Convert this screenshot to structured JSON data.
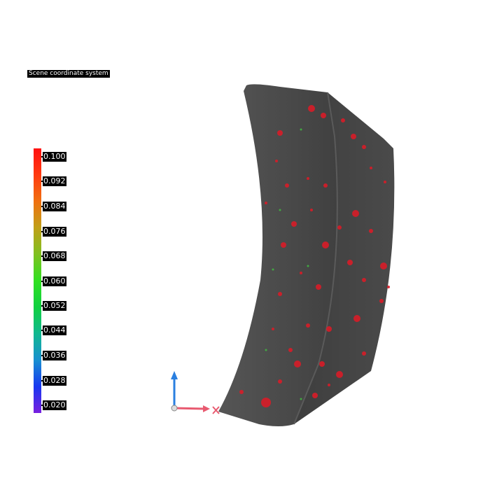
{
  "scene": {
    "coordinate_label": "Scene coordinate system"
  },
  "legend": {
    "ticks": [
      "0.100",
      "0.092",
      "0.084",
      "0.076",
      "0.068",
      "0.060",
      "0.052",
      "0.044",
      "0.036",
      "0.028",
      "0.020"
    ],
    "colors": {
      "max": "#ff1010",
      "mid": "#30e020",
      "min": "#7820e0"
    }
  },
  "axes": {
    "up_icon": "z-axis-arrow-icon",
    "right_icon": "x-axis-arrow-icon",
    "marker_icon": "x-marker-icon",
    "colors": {
      "z": "#2a7fe0",
      "x": "#e85a70"
    }
  },
  "model": {
    "body_color": "#4a4a4a",
    "highlight_color": "#e0202a"
  }
}
